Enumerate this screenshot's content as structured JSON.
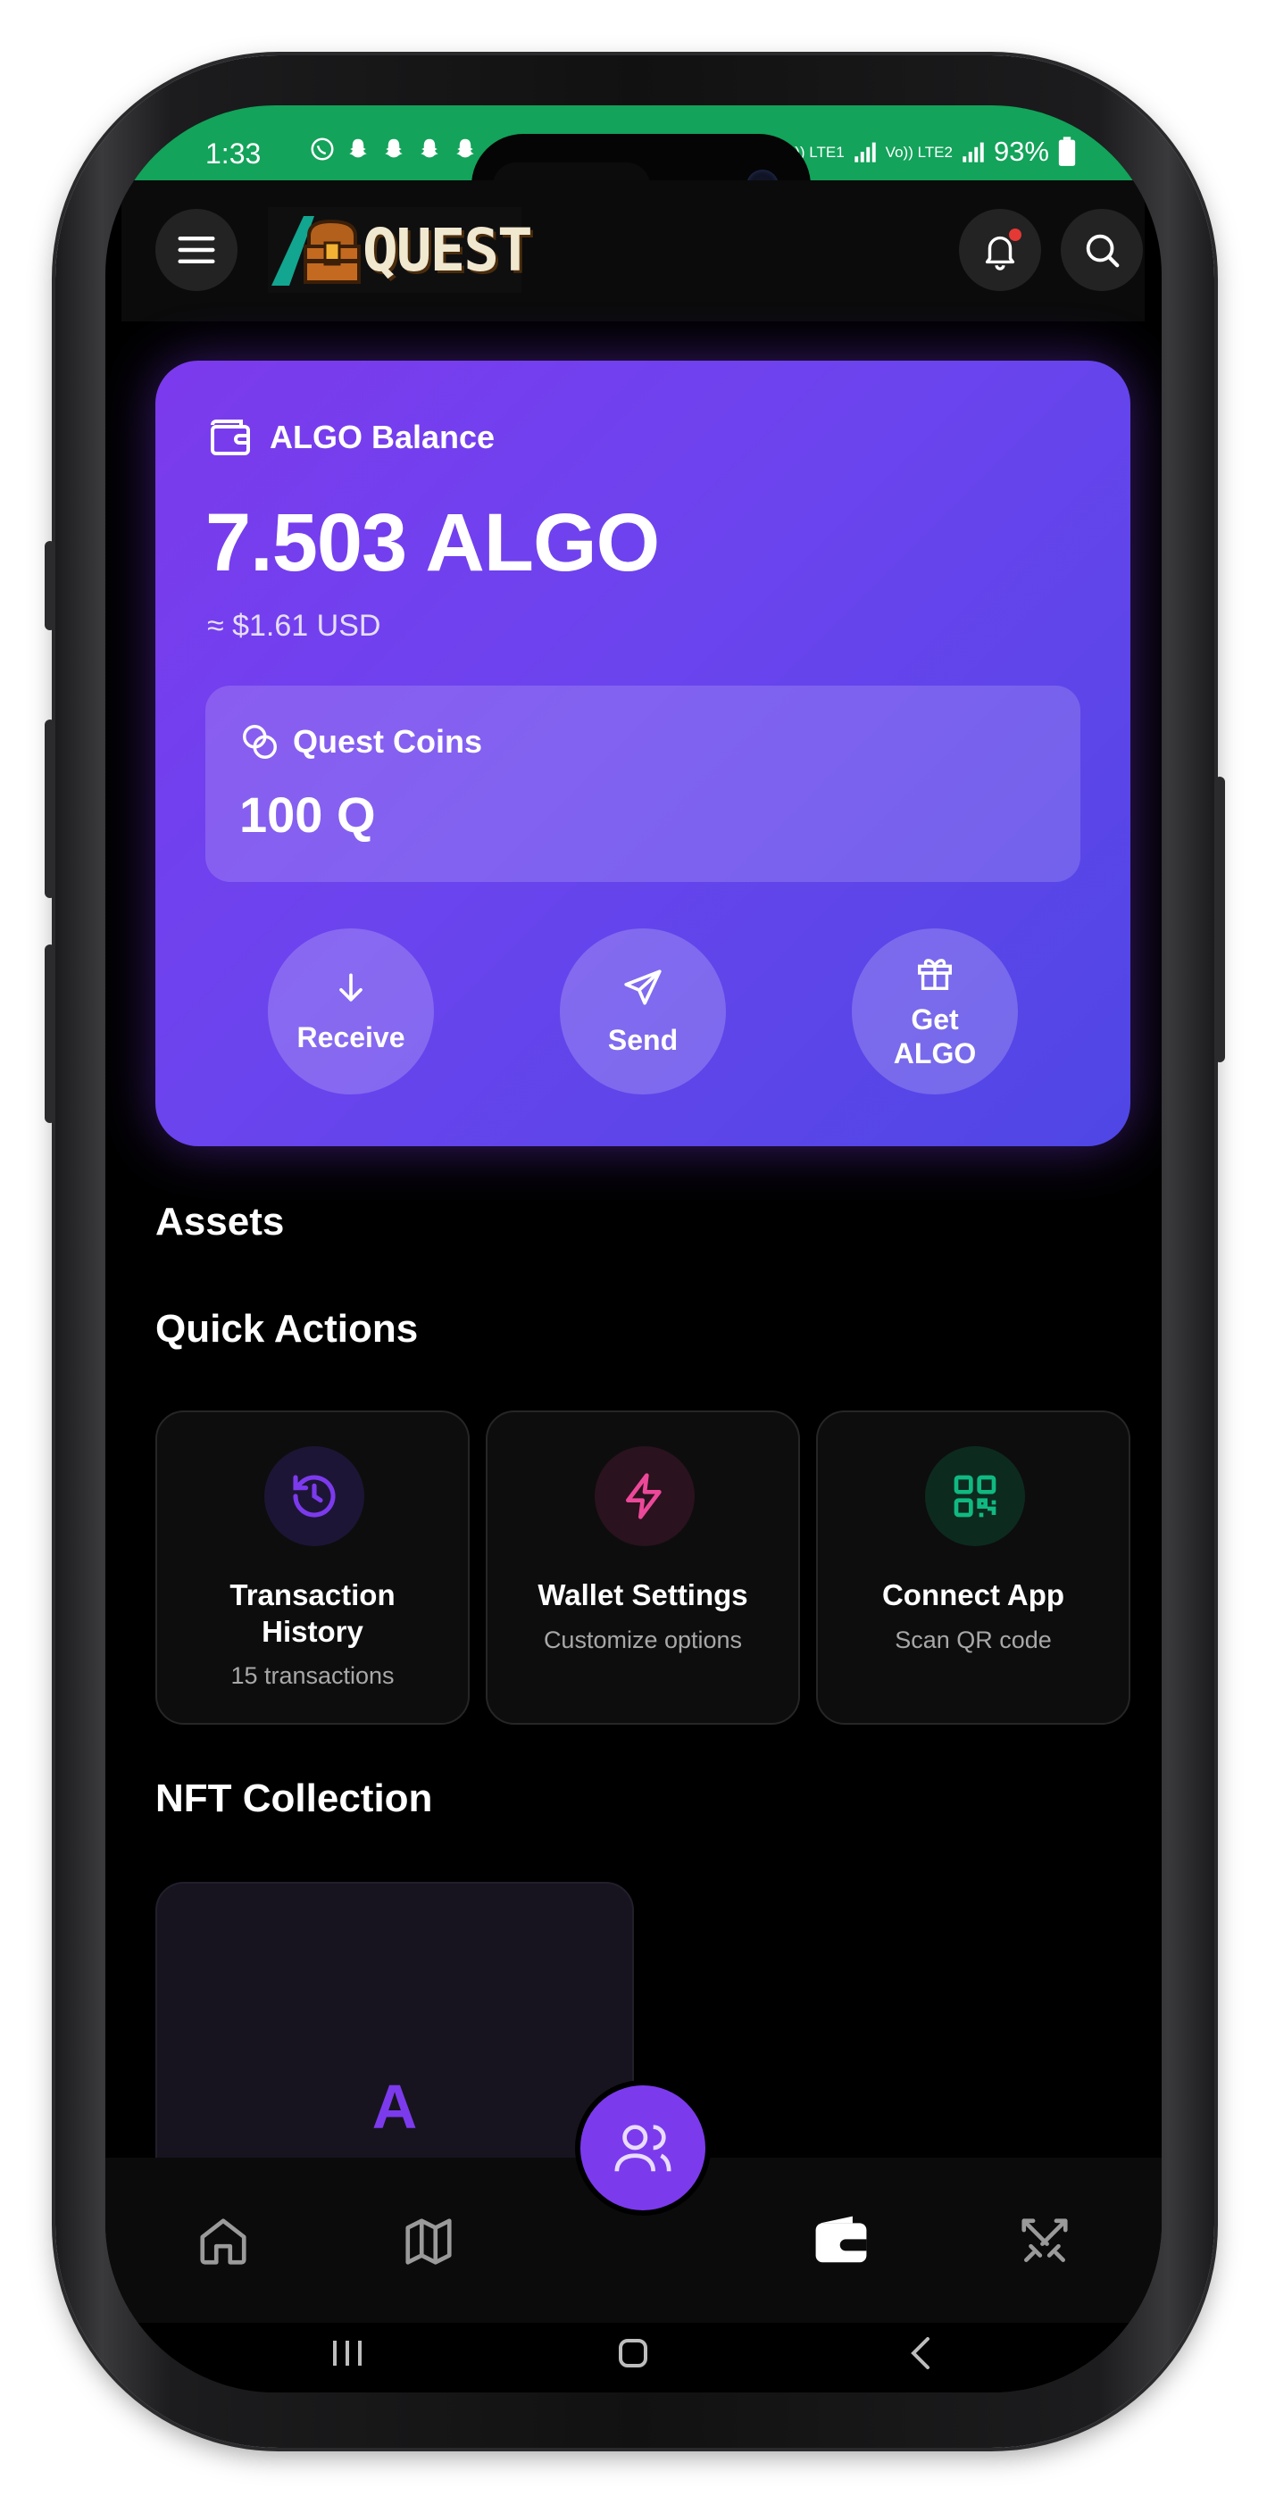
{
  "status_bar": {
    "time": "1:33",
    "battery": "93%",
    "network_1": "Vo)) LTE1",
    "network_2": "Vo)) LTE2"
  },
  "header": {
    "logo_text": "QUEST",
    "menu_icon": "hamburger-menu-icon",
    "notification_icon": "bell-icon",
    "search_icon": "search-icon"
  },
  "balance_card": {
    "title": "ALGO Balance",
    "amount": "7.503 ALGO",
    "usd": "≈ $1.61 USD",
    "quest_coins": {
      "title": "Quest Coins",
      "amount": "100 Q"
    },
    "actions": [
      {
        "label": "Receive",
        "icon": "arrow-down-icon"
      },
      {
        "label": "Send",
        "icon": "send-icon"
      },
      {
        "label": "Get ALGO",
        "icon": "gift-icon"
      }
    ],
    "colors": {
      "from": "#7c3aed",
      "to": "#4f46e5"
    }
  },
  "sections": {
    "assets": "Assets",
    "quick_actions": "Quick Actions",
    "nft_collection": "NFT Collection"
  },
  "quick_actions": [
    {
      "title": "Transaction History",
      "subtitle": "15 transactions",
      "icon": "history-icon",
      "color": "#7c3aed"
    },
    {
      "title": "Wallet Settings",
      "subtitle": "Customize options",
      "icon": "lightning-icon",
      "color": "#ec4899"
    },
    {
      "title": "Connect App",
      "subtitle": "Scan QR code",
      "icon": "qr-code-icon",
      "color": "#10b981"
    }
  ],
  "nft": {
    "placeholder_letter": "A"
  },
  "bottom_nav": {
    "items": [
      {
        "name": "home",
        "icon": "home-icon"
      },
      {
        "name": "map",
        "icon": "map-icon"
      },
      {
        "name": "community",
        "icon": "users-icon"
      },
      {
        "name": "wallet",
        "icon": "wallet-icon",
        "active": true
      },
      {
        "name": "battle",
        "icon": "crossed-swords-icon"
      }
    ]
  }
}
